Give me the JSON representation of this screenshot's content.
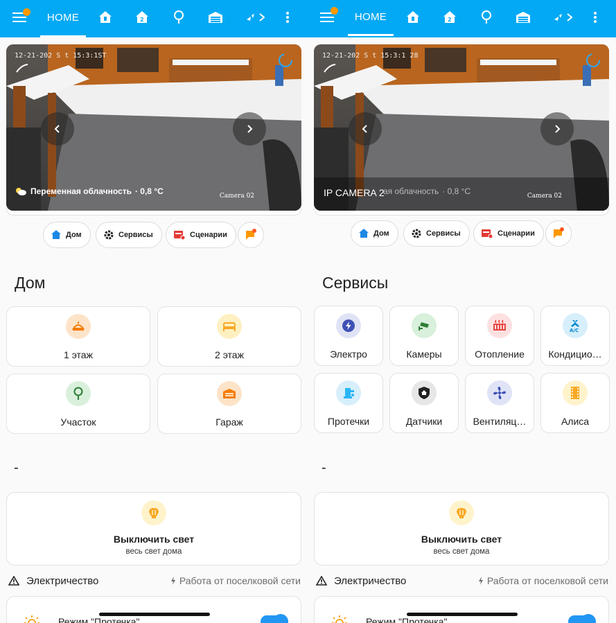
{
  "header": {
    "home_label": "HOME",
    "icons": [
      "menu-icon",
      "home-floor-icon",
      "home-floor-2-icon",
      "tree-icon",
      "garage-icon",
      "tab-more-icon",
      "more-vert-icon"
    ]
  },
  "left": {
    "camera": {
      "timestamp": "12-21-202 S t 15:3:1ST",
      "weather_text": "Переменная облачность",
      "temperature": "· 0,8 °C",
      "camera_name": "Camera 02"
    },
    "chips": [
      "Дом",
      "Сервисы",
      "Сценарии"
    ],
    "section_title": "Дом",
    "tiles": [
      "1 этаж",
      "2 этаж",
      "Участок",
      "Гараж"
    ]
  },
  "right": {
    "camera": {
      "timestamp": "12-21-202 S t 15:3:1 28",
      "overlay_label": "IP CAMERA 2",
      "weather_text": "ая облачность",
      "temperature": "· 0,8 °C",
      "camera_name": "Camera 02"
    },
    "chips": [
      "Дом",
      "Сервисы",
      "Сценарии"
    ],
    "section_title": "Сервисы",
    "tiles": [
      "Электро",
      "Камеры",
      "Отопление",
      "Кондицио…",
      "Протечки",
      "Датчики",
      "Вентиляц…",
      "Алиса"
    ]
  },
  "common": {
    "dash": "-",
    "off_title": "Выключить свет",
    "off_sub": "весь свет дома",
    "elec_title": "Электричество",
    "elec_status": "Работа от поселковой сети",
    "bottom_card_text": "Режим \"Протечка\""
  },
  "colors": {
    "topbar": "#03a9f4",
    "accent_orange": "#ff9800",
    "home_blue": "#1e88e5",
    "toggle": "#2196f3"
  }
}
